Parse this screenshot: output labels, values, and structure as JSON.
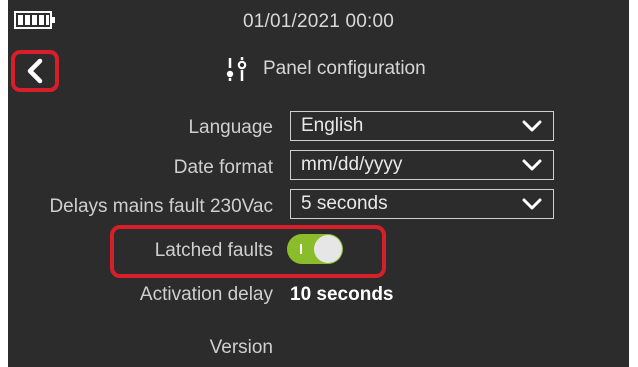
{
  "status": {
    "datetime": "01/01/2021  00:00",
    "battery_icon": "battery-icon"
  },
  "header": {
    "title": "Panel configuration",
    "title_icon": "sliders-icon",
    "back_icon": "chevron-left-icon"
  },
  "settings": {
    "language": {
      "label": "Language",
      "value": "English"
    },
    "date_format": {
      "label": "Date format",
      "value": "mm/dd/yyyy"
    },
    "mains_fault_delay": {
      "label": "Delays mains fault 230Vac",
      "value": "5 seconds"
    },
    "latched_faults": {
      "label": "Latched faults",
      "enabled": true
    },
    "activation_delay": {
      "label": "Activation delay",
      "value": "10 seconds"
    },
    "version": {
      "label": "Version"
    }
  },
  "colors": {
    "screen_background": "#2c2c2c",
    "highlight_outline": "#d71f2a",
    "toggle_on": "#8bbd2a"
  }
}
